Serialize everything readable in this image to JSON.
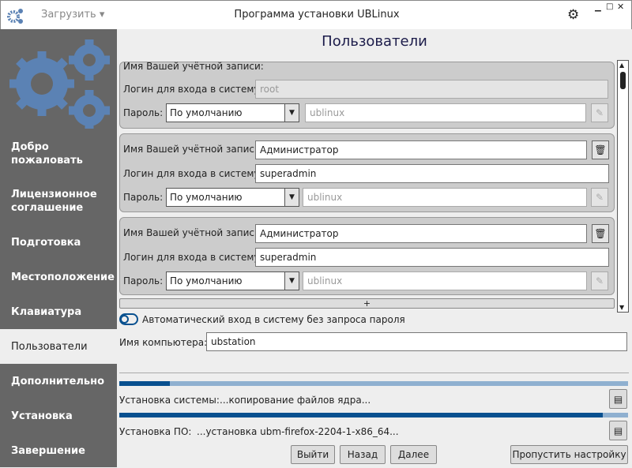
{
  "titlebar": {
    "title": "Программа установки UBLinux",
    "menu_label": "Загрузить",
    "icons": [
      "gears-icon",
      "gear-icon",
      "minimize-icon",
      "maximize-icon",
      "close-icon"
    ]
  },
  "sidebar": {
    "items": [
      {
        "label": "Добро пожаловать"
      },
      {
        "label": "Лицензионное соглашение"
      },
      {
        "label": "Подготовка"
      },
      {
        "label": "Местоположение"
      },
      {
        "label": "Клавиатура"
      },
      {
        "label": "Пользователи",
        "active": true
      },
      {
        "label": "Дополнительно"
      },
      {
        "label": "Установка"
      },
      {
        "label": "Завершение"
      }
    ]
  },
  "page": {
    "title": "Пользователи"
  },
  "users": [
    {
      "name_label": "Имя Вашей учётной записи:",
      "name": "",
      "login_label": "Логин для входа в систему:",
      "login": "root",
      "password_label": "Пароль:",
      "password_mode": "По умолчанию",
      "password": "ublinux"
    },
    {
      "name_label": "Имя Вашей учётной записи:",
      "name": "Администратор",
      "login_label": "Логин для входа в систему:",
      "login": "superadmin",
      "password_label": "Пароль:",
      "password_mode": "По умолчанию",
      "password": "ublinux"
    },
    {
      "name_label": "Имя Вашей учётной записи:",
      "name": "Администратор",
      "login_label": "Логин для входа в систему:",
      "login": "superadmin",
      "password_label": "Пароль:",
      "password_mode": "По умолчанию",
      "password": "ublinux"
    }
  ],
  "add_label": "+",
  "autologin": {
    "label": "Автоматический вход в систему без запроса пароля",
    "enabled": false
  },
  "computer": {
    "label": "Имя компьютера:",
    "value": "ubstation"
  },
  "progress": [
    {
      "label": "Установка системы:",
      "status": "...копирование файлов ядра...",
      "percent": 10
    },
    {
      "label": "Установка ПО:",
      "status": "...установка ubm-firefox-2204-1-x86_64...",
      "percent": 95
    }
  ],
  "buttons": {
    "exit": "Выйти",
    "back": "Назад",
    "next": "Далее",
    "skip": "Пропустить настройку"
  },
  "colors": {
    "accent": "#08508f",
    "gear": "#5b82b4",
    "sidebar": "#666666"
  }
}
